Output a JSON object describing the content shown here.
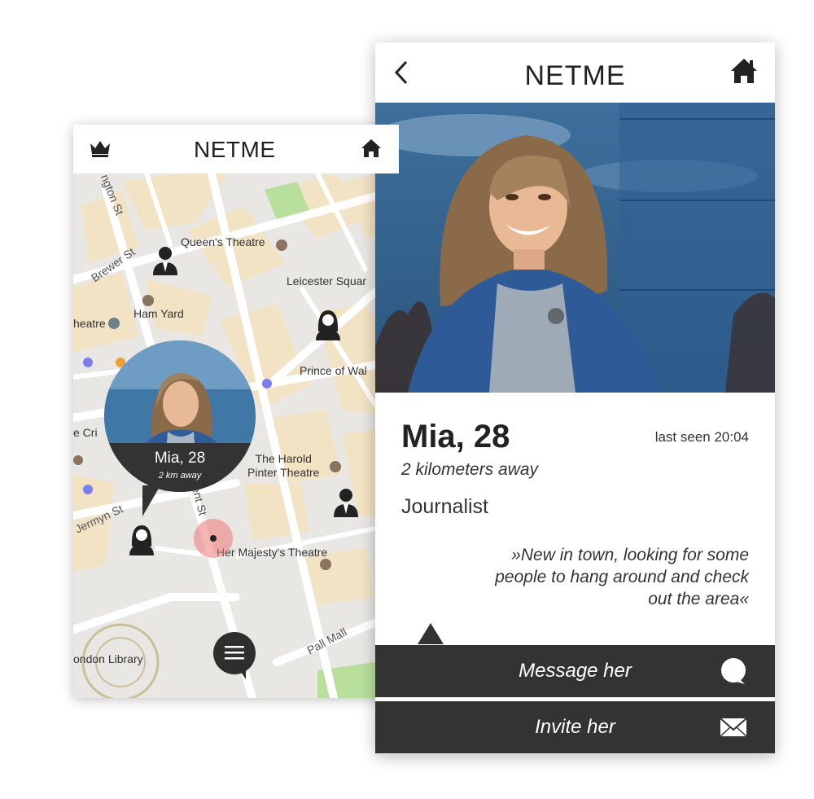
{
  "map_screen": {
    "title": "NETME",
    "header_icons": [
      "crown-icon",
      "home-icon"
    ],
    "places": {
      "queens_theatre": "Queen's Theatre",
      "leicester_square": "Leicester Squar",
      "ham_yard": "Ham Yard",
      "theatre": "heatre",
      "prince_of_wales": "Prince of Wal",
      "the_criterion": "e Cri",
      "harold_pinter": "The Harold\nPinter Theatre",
      "her_majestys": "Her Majesty's Theatre",
      "london_library": "ondon Library"
    },
    "streets": {
      "newton_st": "ngton St",
      "brewer_st": "Brewer St",
      "jermyn_st": "Jermyn St",
      "regent_st": "gent St",
      "pall_mall": "Pall Mall"
    },
    "bubble": {
      "name": "Mia, 28",
      "distance": "2 km away"
    },
    "menu_icon": "hamburger-icon"
  },
  "profile_screen": {
    "title": "NETME",
    "back_icon": "chevron-left-icon",
    "home_icon": "home-icon",
    "name": "Mia, 28",
    "last_seen": "last seen 20:04",
    "distance": "2 kilometers away",
    "occupation": "Journalist",
    "quote": "»New in town, looking for some people to hang around and check out the area«",
    "actions": {
      "message": {
        "label": "Message her",
        "icon": "chat-bubble-icon"
      },
      "invite": {
        "label": "Invite her",
        "icon": "envelope-icon"
      }
    }
  },
  "colors": {
    "dark_bar": "#333333",
    "map_background": "#e9e7e3",
    "map_block": "#f2e3c4",
    "map_park": "#b9df9c",
    "location_halo": "#ec7878"
  }
}
